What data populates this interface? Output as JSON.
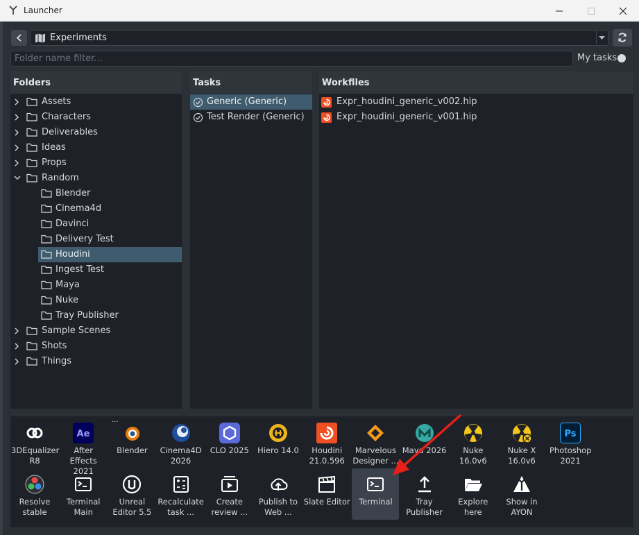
{
  "window": {
    "title": "Launcher"
  },
  "nav": {
    "project": "Experiments"
  },
  "filter": {
    "placeholder": "Folder name filter...",
    "my_tasks_label": "My tasks"
  },
  "folders": {
    "header": "Folders",
    "items": [
      {
        "label": "Assets",
        "expandable": true,
        "expanded": false,
        "level": 0
      },
      {
        "label": "Characters",
        "expandable": true,
        "expanded": false,
        "level": 0
      },
      {
        "label": "Deliverables",
        "expandable": true,
        "expanded": false,
        "level": 0
      },
      {
        "label": "Ideas",
        "expandable": true,
        "expanded": false,
        "level": 0
      },
      {
        "label": "Props",
        "expandable": true,
        "expanded": false,
        "level": 0
      },
      {
        "label": "Random",
        "expandable": true,
        "expanded": true,
        "level": 0
      },
      {
        "label": "Blender",
        "expandable": false,
        "level": 1
      },
      {
        "label": "Cinema4d",
        "expandable": false,
        "level": 1
      },
      {
        "label": "Davinci",
        "expandable": false,
        "level": 1
      },
      {
        "label": "Delivery Test",
        "expandable": false,
        "level": 1
      },
      {
        "label": "Houdini",
        "expandable": false,
        "level": 1,
        "selected": true
      },
      {
        "label": "Ingest Test",
        "expandable": false,
        "level": 1
      },
      {
        "label": "Maya",
        "expandable": false,
        "level": 1
      },
      {
        "label": "Nuke",
        "expandable": false,
        "level": 1
      },
      {
        "label": "Tray Publisher",
        "expandable": false,
        "level": 1
      },
      {
        "label": "Sample Scenes",
        "expandable": true,
        "expanded": false,
        "level": 0
      },
      {
        "label": "Shots",
        "expandable": true,
        "expanded": false,
        "level": 0
      },
      {
        "label": "Things",
        "expandable": true,
        "expanded": false,
        "level": 0
      }
    ]
  },
  "tasks": {
    "header": "Tasks",
    "items": [
      {
        "label": "Generic (Generic)",
        "selected": true
      },
      {
        "label": "Test Render (Generic)",
        "selected": false
      }
    ]
  },
  "workfiles": {
    "header": "Workfiles",
    "items": [
      {
        "label": "Expr_houdini_generic_v002.hip"
      },
      {
        "label": "Expr_houdini_generic_v001.hip"
      }
    ]
  },
  "apps": {
    "row1": [
      {
        "name": "3dequalizer",
        "label": "3DEqualizer R8",
        "icon": "3dequalizer-icon"
      },
      {
        "name": "after-effects",
        "label": "After Effects 2021",
        "icon": "after-effects-icon"
      },
      {
        "name": "blender",
        "label": "Blender",
        "icon": "blender-icon"
      },
      {
        "name": "cinema4d",
        "label": "Cinema4D 2026",
        "icon": "cinema4d-icon"
      },
      {
        "name": "clo",
        "label": "CLO 2025",
        "icon": "clo-icon"
      },
      {
        "name": "hiero",
        "label": "Hiero 14.0",
        "icon": "hiero-icon"
      },
      {
        "name": "houdini",
        "label": "Houdini 21.0.596",
        "icon": "houdini-icon"
      },
      {
        "name": "marvelous-designer",
        "label": "Marvelous Designer ...",
        "icon": "marvelous-designer-icon"
      },
      {
        "name": "maya",
        "label": "Maya 2026",
        "icon": "maya-icon"
      },
      {
        "name": "nuke",
        "label": "Nuke 16.0v6",
        "icon": "nuke-icon"
      },
      {
        "name": "nuke-x",
        "label": "Nuke X 16.0v6",
        "icon": "nuke-x-icon"
      },
      {
        "name": "photoshop",
        "label": "Photoshop 2021",
        "icon": "photoshop-icon"
      }
    ],
    "row2": [
      {
        "name": "resolve",
        "label": "Resolve stable",
        "icon": "resolve-icon"
      },
      {
        "name": "terminal-main",
        "label": "Terminal Main",
        "icon": "terminal-icon"
      },
      {
        "name": "unreal",
        "label": "Unreal Editor 5.5",
        "icon": "unreal-icon"
      },
      {
        "name": "recalculate",
        "label": "Recalculate task ...",
        "icon": "calculator-icon"
      },
      {
        "name": "create-review",
        "label": "Create review ...",
        "icon": "review-icon"
      },
      {
        "name": "publish-web",
        "label": "Publish to Web ...",
        "icon": "cloud-upload-icon"
      },
      {
        "name": "slate-editor",
        "label": "Slate Editor",
        "icon": "clapperboard-icon"
      },
      {
        "name": "terminal",
        "label": "Terminal",
        "icon": "terminal-icon",
        "active": true
      },
      {
        "name": "tray-publisher",
        "label": "Tray Publisher",
        "icon": "upload-icon"
      },
      {
        "name": "explore-here",
        "label": "Explore here",
        "icon": "folder-open-icon"
      },
      {
        "name": "show-in-ayon",
        "label": "Show in AYON",
        "icon": "ayon-icon"
      }
    ],
    "overflow_marker": "..."
  },
  "colors": {
    "background": "#2b2f36",
    "panel": "#1e2228",
    "selection": "#3f5c6e",
    "annotation_arrow": "#e8201a"
  }
}
